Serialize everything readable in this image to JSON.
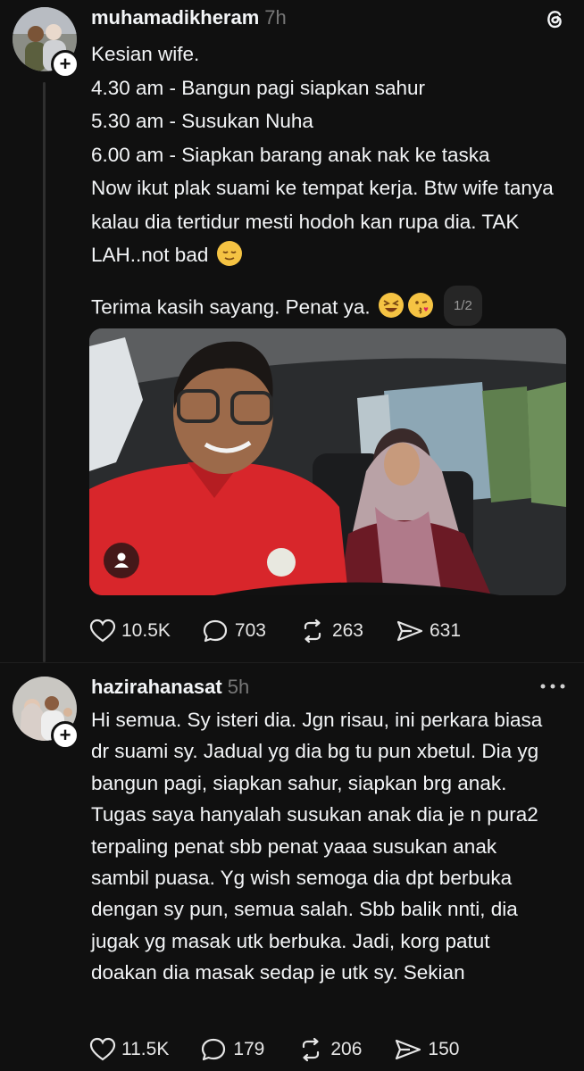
{
  "post1": {
    "username": "muhamadikheram",
    "time": "7h",
    "lines": [
      "Kesian wife.",
      "4.30 am - Bangun pagi siapkan sahur",
      "5.30 am - Susukan Nuha",
      "6.00 am - Siapkan barang anak nak ke taska",
      "Now ikut plak suami ke tempat kerja. Btw wife tanya kalau dia tertidur mesti hodoh kan rupa dia. TAK LAH..not bad"
    ],
    "closing": "Terima kasih sayang. Penat ya.",
    "page_indicator": "1/2",
    "likes": "10.5K",
    "comments": "703",
    "reposts": "263",
    "shares": "631"
  },
  "post2": {
    "username": "hazirahanasat",
    "time": "5h",
    "text": "Hi semua. Sy isteri dia. Jgn risau, ini perkara biasa dr suami sy. Jadual yg dia bg tu pun xbetul. Dia yg bangun pagi, siapkan sahur, siapkan brg anak. Tugas saya hanyalah susukan anak dia je n pura2 terpaling penat sbb penat yaaa susukan anak sambil puasa. Yg wish semoga dia dpt berbuka dengan sy pun, semua salah. Sbb balik nnti, dia jugak yg masak utk berbuka. Jadi, korg patut doakan dia masak sedap je utk sy. Sekian",
    "likes": "11.5K",
    "comments": "179",
    "reposts": "206",
    "shares": "150"
  },
  "icons": {
    "app_logo": "threads-logo-icon",
    "more": "more-dots-icon",
    "like": "heart-icon",
    "comment": "comment-bubble-icon",
    "repost": "repost-icon",
    "share": "send-icon",
    "photo_tag": "person-tag-icon"
  }
}
